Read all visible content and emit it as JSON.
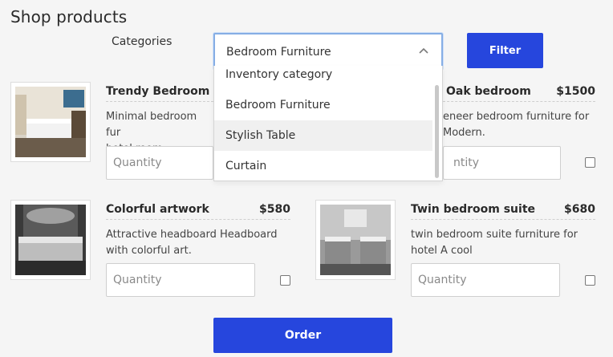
{
  "page": {
    "title": "Shop products"
  },
  "filters": {
    "categories_label": "Categories",
    "selected_category": "Bedroom Furniture",
    "filter_button": "Filter"
  },
  "dropdown": {
    "options": [
      "Inventory category",
      "Bedroom Furniture",
      "Stylish Table",
      "Curtain"
    ],
    "hovered": "Stylish Table"
  },
  "products": [
    {
      "name": "Trendy Bedroom th",
      "price": "",
      "description_lines": [
        "Minimal bedroom fur",
        "hotel room."
      ],
      "quantity_placeholder": "Quantity",
      "image_icon": "hotel-bedroom-photo"
    },
    {
      "name": "Oak bedroom",
      "price": "$1500",
      "description_lines": [
        "eneer bedroom furniture for",
        "Modern."
      ],
      "quantity_placeholder": "ntity",
      "image_icon": "bedroom-photo"
    },
    {
      "name": "Colorful artwork",
      "price": "$580",
      "description_lines": [
        "Attractive headboard Headboard",
        "with colorful art."
      ],
      "quantity_placeholder": "Quantity",
      "image_icon": "dark-bedroom-photo"
    },
    {
      "name": "Twin bedroom suite",
      "price": "$680",
      "description_lines": [
        "twin bedroom suite furniture for",
        "hotel A cool"
      ],
      "quantity_placeholder": "Quantity",
      "image_icon": "twin-bedroom-photo"
    }
  ],
  "actions": {
    "order_button": "Order"
  },
  "colors": {
    "primary": "#2646dd",
    "background": "#f5f5f5",
    "select_focus": "#86aee5"
  }
}
